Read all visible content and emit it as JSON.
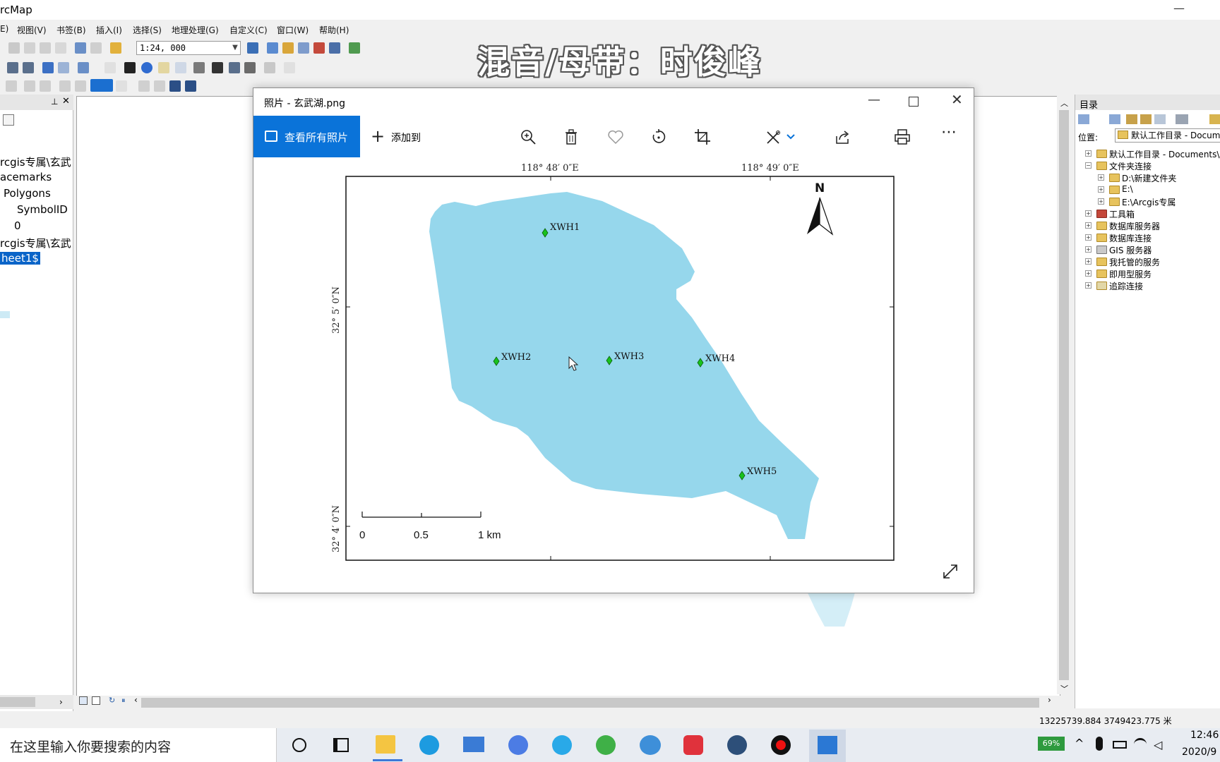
{
  "arcmap": {
    "title": "rcMap",
    "minimize_glyph": "—",
    "menus": [
      "E)",
      "视图(V)",
      "书签(B)",
      "插入(I)",
      "选择(S)",
      "地理处理(G)",
      "自定义(C)",
      "窗口(W)",
      "帮助(H)"
    ],
    "scale": "1:24, 000",
    "toc": {
      "lines": [
        "rcgis专属\\玄武",
        "acemarks",
        "Polygons",
        "SymbolID",
        "0",
        "rcgis专属\\玄武",
        "heet1$"
      ]
    },
    "catalog": {
      "title": "目录",
      "location_label": "位置:",
      "location_value": "默认工作目录 - Documen",
      "items": [
        {
          "label": "默认工作目录 - Documents\\A",
          "indent": 0,
          "expander": "+"
        },
        {
          "label": "文件夹连接",
          "indent": 0,
          "expander": "−"
        },
        {
          "label": "D:\\新建文件夹",
          "indent": 1,
          "expander": "+"
        },
        {
          "label": "E:\\",
          "indent": 1,
          "expander": "+"
        },
        {
          "label": "E:\\Arcgis专属",
          "indent": 1,
          "expander": "+"
        },
        {
          "label": "工具箱",
          "indent": 0,
          "expander": "+"
        },
        {
          "label": "数据库服务器",
          "indent": 0,
          "expander": "+"
        },
        {
          "label": "数据库连接",
          "indent": 0,
          "expander": "+"
        },
        {
          "label": "GIS 服务器",
          "indent": 0,
          "expander": "+"
        },
        {
          "label": "我托管的服务",
          "indent": 0,
          "expander": "+"
        },
        {
          "label": "即用型服务",
          "indent": 0,
          "expander": "+"
        },
        {
          "label": "追踪连接",
          "indent": 0,
          "expander": "+"
        }
      ]
    },
    "status_coords": "13225739.884  3749423.775 米"
  },
  "watermark": "混音/母带：时俊峰",
  "photos": {
    "title": "照片 - 玄武湖.png",
    "minimize_glyph": "—",
    "close_glyph": "✕",
    "view_all": "查看所有照片",
    "add_to_icon": "+",
    "add_to": "添加到",
    "more_glyph": "⋯",
    "map": {
      "top_ticks": [
        "118° 48′ 0″E",
        "118° 49′ 0″E"
      ],
      "left_ticks": [
        "32° 5′ 0″N",
        "32° 4′ 0″N"
      ],
      "north": "N",
      "scale_labels": [
        "0",
        "0.5",
        "1 km"
      ],
      "points": [
        "XWH1",
        "XWH2",
        "XWH3",
        "XWH4",
        "XWH5"
      ]
    }
  },
  "taskbar": {
    "search_placeholder": "在这里输入你要搜索的内容",
    "battery": "69%",
    "time": "12:46",
    "date": "2020/9"
  },
  "colors": {
    "lake": "#96d7ec",
    "photos_accent": "#0a73d9",
    "point_green": "#19c21d"
  }
}
